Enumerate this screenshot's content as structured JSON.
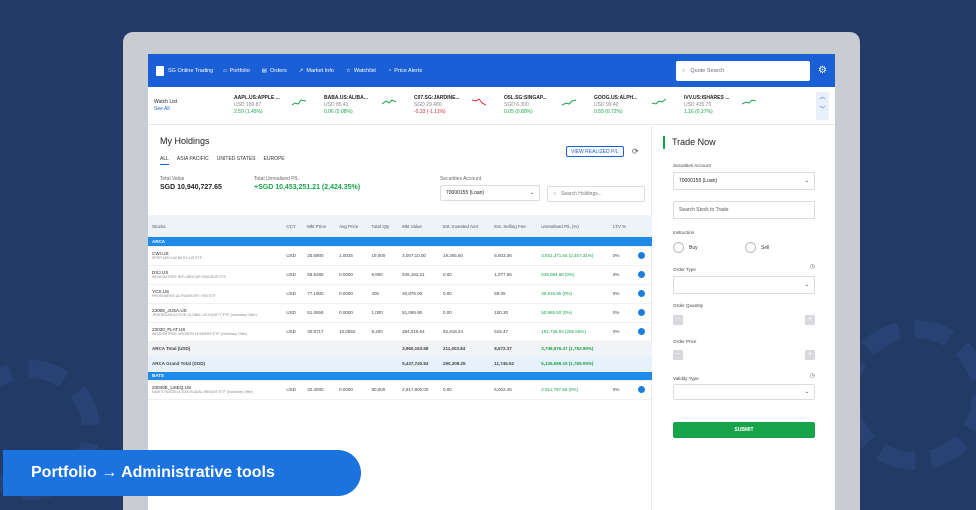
{
  "nav": {
    "brand": "SG Online Trading",
    "items": [
      "Portfolio",
      "Orders",
      "Market Info",
      "Watchlist",
      "Price Alerts"
    ],
    "search_placeholder": "Quote Search"
  },
  "watchlist": {
    "title": "Watch List",
    "edit": "See All"
  },
  "tickers": [
    {
      "name": "AAPL.US:APPLE ...",
      "ccy": "USD 189.87",
      "chg": "2.59 (1.45%)",
      "dir": "up"
    },
    {
      "name": "BABA.US:ALIBA...",
      "ccy": "USD 85.41",
      "chg": "0.06 (0.08%)",
      "dir": "up"
    },
    {
      "name": "C07.SG:JARDINE...",
      "ccy": "SGD 29.480",
      "chg": "-0.33 (-1.11%)",
      "dir": "dn"
    },
    {
      "name": "O5L.SG:SINGAP...",
      "ccy": "SGD 6.300",
      "chg": "0.05 (0.80%)",
      "dir": "up"
    },
    {
      "name": "GOOG.US:ALPH...",
      "ccy": "USD 99.40",
      "chg": "0.55 (0.72%)",
      "dir": "up"
    },
    {
      "name": "IVV.US:ISHARES ...",
      "ccy": "USD 435.70",
      "chg": "1.16 (0.27%)",
      "dir": "up"
    }
  ],
  "holdings": {
    "title": "My Holdings",
    "regions": [
      "ALL",
      "ASIA PACIFIC",
      "UNITED STATES",
      "EUROPE"
    ],
    "view_btn": "VIEW REALIZED P/L",
    "total_label": "Total Value",
    "total": "SGD 10,940,727.65",
    "upl_label": "Total Unrealized P/L",
    "upl": "+SGD 10,453,251.21 (2,424.35%)",
    "acct_label": "Securities Account",
    "acct": "70000155 (Loan)",
    "search_placeholder": "Search Holdings..."
  },
  "table": {
    "headers": [
      "Stocks",
      "CCY",
      "Mkt Price",
      "Avg Price",
      "Total Qty",
      "Mkt Value",
      "Est. Invested Amt",
      "Est. Selling Fee",
      "Unrealised P/L (%)",
      "LTV %"
    ],
    "groups": [
      {
        "name": "ARCA",
        "rows": [
          {
            "sym": "CWI.US",
            "sub": "SPDR MSCI ACWI EX-US ETF",
            "ccy": "USD",
            "mp": "25.6900",
            "ap": "1.0035",
            "qty": "19,000",
            "mv": "3,007,10.00",
            "inv": "19,255.60",
            "fee": "6,603.36",
            "pl": "3,931,371.64 (2,457.31%)",
            "ltv": "0%"
          },
          {
            "sym": "DXJ.US",
            "sub": "WISDOMTREE INTL MIDCAP DIVIDEND ETF",
            "ccy": "USD",
            "mp": "55.6285",
            "ap": "0.0000",
            "qty": "9,800",
            "mv": "545,162.21",
            "inv": "0.00",
            "fee": "1,077.55",
            "pl": "545,084.66 (0%)",
            "ltv": "0%"
          },
          {
            "sym": "YCS.US",
            "sub": "PROSHARES ULTRASHORT YEN ETF",
            "ccy": "USD",
            "mp": "77.1900",
            "ap": "0.0000",
            "qty": "400",
            "mv": "30,876.00",
            "inv": "0.00",
            "fee": "59.05",
            "pl": "30,816.95 (0%)",
            "ltv": "0%"
          },
          {
            "sym": "23006_JUSA.US",
            "sub": "JPMORGAN ACTIVE GLOBAL US EQUITY ETF (Voluntary Offer)",
            "ccy": "USD",
            "mp": "51.0659",
            "ap": "0.0000",
            "qty": "1,000",
            "mv": "51,065.90",
            "inv": "0.00",
            "fee": "100.30",
            "pl": "50,965.60 (0%)",
            "ltv": "0%"
          },
          {
            "sym": "23030_FLAT.US",
            "sub": "WISDOMTREE GROWTH LEADERS ETF (Voluntary Offer)",
            "ccy": "USD",
            "mp": "30.8717",
            "ap": "10.0852",
            "qty": "9,200",
            "mv": "284,019.64",
            "inv": "92,818.24",
            "fee": "615.47",
            "pl": "191,736.93 (206.56%)",
            "ltv": "0%"
          }
        ],
        "total_label": "ARCA Total (USD)",
        "total": {
          "mv": "3,960,153.68",
          "inv": "211,003.84",
          "fee": "8,572.37",
          "pl": "3,749,976.47 (1,782.95%)"
        },
        "gtotal_label": "ARCA Grand Total (SGD)",
        "gtotal": {
          "mv": "5,437,740.84",
          "inv": "290,308.25",
          "fee": "11,745.52",
          "pl": "5,135,689.15 (1,769.05%)"
        }
      },
      {
        "name": "BATS",
        "rows": [
          {
            "sym": "23040E_USEQ.US",
            "sub": "NAVITI RUSSELL 1000 EQUAL WEIGHT ETF (Voluntary Offer)",
            "ccy": "USD",
            "mp": "32.4000",
            "ap": "0.0000",
            "qty": "90,000",
            "mv": "2,917,800.00",
            "inv": "0.00",
            "fee": "6,002.45",
            "pl": "2,911,797.55 (0%)",
            "ltv": "0%"
          }
        ]
      }
    ]
  },
  "trade": {
    "title": "Trade Now",
    "acct_label": "Securities Account",
    "acct": "70000155 (Loan)",
    "stock_placeholder": "Search Stock to Trade",
    "instr_label": "Instruction",
    "buy": "Buy",
    "sell": "Sell",
    "type_label": "Order Type",
    "qty_label": "Order Quantity",
    "price_label": "Order Price",
    "validity_label": "Validity Type",
    "submit": "SUBMIT"
  },
  "banner": "Portfolio → Administrative tools"
}
